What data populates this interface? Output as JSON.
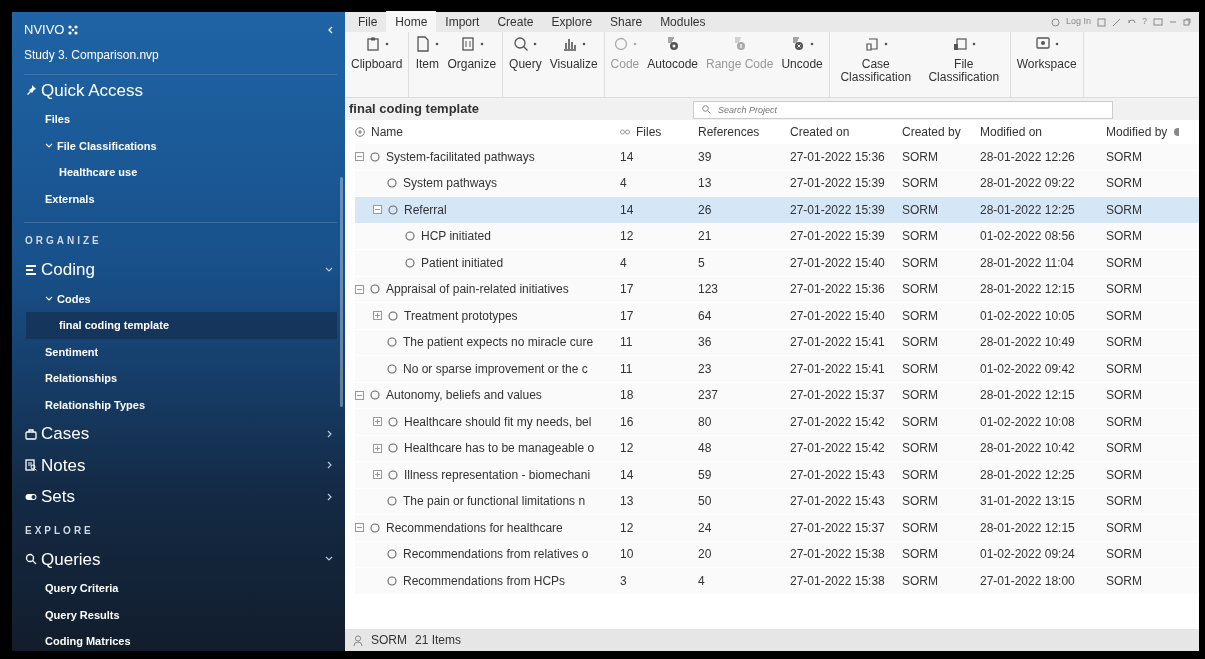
{
  "sidebar": {
    "brand": "NVIVO",
    "project": "Study 3. Comparison.nvp",
    "sections": [
      {
        "heading": "Quick Access",
        "items": [
          {
            "label": "Files",
            "selected": false
          },
          {
            "label": "File Classifications",
            "selected": false,
            "expanded": true,
            "children": [
              {
                "label": "Healthcare use",
                "selected": false
              }
            ]
          },
          {
            "label": "Externals",
            "selected": false
          }
        ]
      },
      {
        "caption": "ORGANIZE"
      },
      {
        "heading": "Coding",
        "expanded": true,
        "items": [
          {
            "label": "Codes",
            "selected": false,
            "expanded": true,
            "children": [
              {
                "label": "final coding template",
                "selected": true
              }
            ]
          },
          {
            "label": "Sentiment",
            "selected": false
          },
          {
            "label": "Relationships",
            "selected": false
          },
          {
            "label": "Relationship Types",
            "selected": false
          }
        ]
      },
      {
        "heading": "Cases",
        "expanded": false
      },
      {
        "heading": "Notes",
        "expanded": false
      },
      {
        "heading": "Sets",
        "expanded": false
      },
      {
        "caption": "EXPLORE"
      },
      {
        "heading": "Queries",
        "expanded": true,
        "items": [
          {
            "label": "Query Criteria",
            "selected": false
          },
          {
            "label": "Query Results",
            "selected": false
          },
          {
            "label": "Coding Matrices",
            "selected": false
          }
        ]
      }
    ]
  },
  "ribbon": {
    "tabs": [
      {
        "label": "File",
        "selected": false
      },
      {
        "label": "Home",
        "selected": true
      },
      {
        "label": "Import",
        "selected": false
      },
      {
        "label": "Create",
        "selected": false
      },
      {
        "label": "Explore",
        "selected": false
      },
      {
        "label": "Share",
        "selected": false
      },
      {
        "label": "Modules",
        "selected": false
      }
    ],
    "account": "Log In",
    "help": "?",
    "groups": [
      [
        {
          "label": "Clipboard",
          "disabled": false,
          "dropdown": true
        }
      ],
      [
        {
          "label": "Item",
          "disabled": false,
          "dropdown": true
        },
        {
          "label": "Organize",
          "disabled": false,
          "dropdown": true
        }
      ],
      [
        {
          "label": "Query",
          "disabled": false,
          "dropdown": true
        },
        {
          "label": "Visualize",
          "disabled": false,
          "dropdown": true
        }
      ],
      [
        {
          "label": "Code",
          "disabled": true,
          "dropdown": true
        },
        {
          "label": "Autocode",
          "disabled": false,
          "dropdown": false
        },
        {
          "label": "Range Code",
          "disabled": true,
          "dropdown": false
        },
        {
          "label": "Uncode",
          "disabled": false,
          "dropdown": true
        }
      ],
      [
        {
          "label": "Case Classification",
          "disabled": false,
          "dropdown": true
        },
        {
          "label": "File Classification",
          "disabled": false,
          "dropdown": true
        }
      ],
      [
        {
          "label": "Workspace",
          "disabled": false,
          "dropdown": true
        }
      ]
    ]
  },
  "view": {
    "title": "final coding template",
    "search": {
      "placeholder": "Search Project"
    },
    "columns": [
      "Name",
      "Files",
      "References",
      "Created on",
      "Created by",
      "Modified on",
      "Modified by"
    ],
    "rows": [
      {
        "name": "System-facilitated pathways",
        "files": "14",
        "references": "39",
        "created_on": "27-01-2022 15:36",
        "created_by": "SORM",
        "modified_on": "28-01-2022 12:26",
        "modified_by": "SORM",
        "selected": false,
        "expanded": true,
        "children": [
          {
            "name": "System pathways",
            "files": "4",
            "references": "13",
            "created_on": "27-01-2022 15:39",
            "created_by": "SORM",
            "modified_on": "28-01-2022 09:22",
            "modified_by": "SORM",
            "selected": false
          },
          {
            "name": "Referral",
            "files": "14",
            "references": "26",
            "created_on": "27-01-2022 15:39",
            "created_by": "SORM",
            "modified_on": "28-01-2022 12:25",
            "modified_by": "SORM",
            "selected": true,
            "expanded": true,
            "children": [
              {
                "name": "HCP initiated",
                "files": "12",
                "references": "21",
                "created_on": "27-01-2022 15:39",
                "created_by": "SORM",
                "modified_on": "01-02-2022 08:56",
                "modified_by": "SORM",
                "selected": false
              },
              {
                "name": "Patient initiated",
                "files": "4",
                "references": "5",
                "created_on": "27-01-2022 15:40",
                "created_by": "SORM",
                "modified_on": "28-01-2022 11:04",
                "modified_by": "SORM",
                "selected": false
              }
            ]
          }
        ]
      },
      {
        "name": "Appraisal of pain-related initiatives",
        "files": "17",
        "references": "123",
        "created_on": "27-01-2022 15:36",
        "created_by": "SORM",
        "modified_on": "28-01-2022 12:15",
        "modified_by": "SORM",
        "selected": false,
        "expanded": true,
        "children": [
          {
            "name": "Treatment prototypes",
            "files": "17",
            "references": "64",
            "created_on": "27-01-2022 15:40",
            "created_by": "SORM",
            "modified_on": "01-02-2022 10:05",
            "modified_by": "SORM",
            "selected": false,
            "expanded": false
          },
          {
            "name": "The patient expects no miracle cure",
            "files": "11",
            "references": "36",
            "created_on": "27-01-2022 15:41",
            "created_by": "SORM",
            "modified_on": "28-01-2022 10:49",
            "modified_by": "SORM",
            "selected": false
          },
          {
            "name": "No or sparse improvement or the c",
            "files": "11",
            "references": "23",
            "created_on": "27-01-2022 15:41",
            "created_by": "SORM",
            "modified_on": "01-02-2022 09:42",
            "modified_by": "SORM",
            "selected": false
          }
        ]
      },
      {
        "name": "Autonomy, beliefs and values",
        "files": "18",
        "references": "237",
        "created_on": "27-01-2022 15:37",
        "created_by": "SORM",
        "modified_on": "28-01-2022 12:15",
        "modified_by": "SORM",
        "selected": false,
        "expanded": true,
        "children": [
          {
            "name": "Healthcare should fit my needs, bel",
            "files": "16",
            "references": "80",
            "created_on": "27-01-2022 15:42",
            "created_by": "SORM",
            "modified_on": "01-02-2022 10:08",
            "modified_by": "SORM",
            "selected": false,
            "expanded": false
          },
          {
            "name": "Healthcare has to be manageable o",
            "files": "12",
            "references": "48",
            "created_on": "27-01-2022 15:42",
            "created_by": "SORM",
            "modified_on": "28-01-2022 10:42",
            "modified_by": "SORM",
            "selected": false,
            "expanded": false
          },
          {
            "name": "Illness representation - biomechani",
            "files": "14",
            "references": "59",
            "created_on": "27-01-2022 15:43",
            "created_by": "SORM",
            "modified_on": "28-01-2022 12:25",
            "modified_by": "SORM",
            "selected": false,
            "expanded": false
          },
          {
            "name": "The pain or functional limitations n",
            "files": "13",
            "references": "50",
            "created_on": "27-01-2022 15:43",
            "created_by": "SORM",
            "modified_on": "31-01-2022 13:15",
            "modified_by": "SORM",
            "selected": false
          }
        ]
      },
      {
        "name": "Recommendations for healthcare",
        "files": "12",
        "references": "24",
        "created_on": "27-01-2022 15:37",
        "created_by": "SORM",
        "modified_on": "28-01-2022 12:15",
        "modified_by": "SORM",
        "selected": false,
        "expanded": true,
        "children": [
          {
            "name": "Recommendations from relatives o",
            "files": "10",
            "references": "20",
            "created_on": "27-01-2022 15:38",
            "created_by": "SORM",
            "modified_on": "01-02-2022 09:24",
            "modified_by": "SORM",
            "selected": false
          },
          {
            "name": "Recommendations from HCPs",
            "files": "3",
            "references": "4",
            "created_on": "27-01-2022 15:38",
            "created_by": "SORM",
            "modified_on": "27-01-2022 18:00",
            "modified_by": "SORM",
            "selected": false
          }
        ]
      }
    ]
  },
  "status_bar": {
    "user": "SORM",
    "count": "21 Items"
  }
}
